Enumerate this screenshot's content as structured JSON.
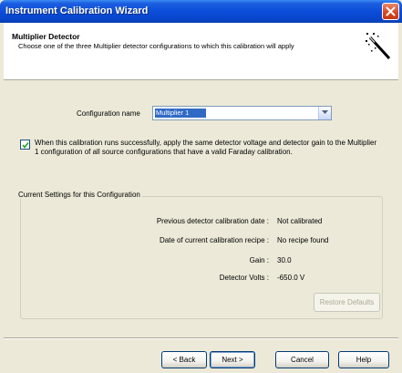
{
  "window": {
    "title": "Instrument Calibration Wizard"
  },
  "header": {
    "title": "Multiplier Detector",
    "subtitle": "Choose one of the three Multiplier detector configurations to which this calibration will apply"
  },
  "configuration": {
    "label": "Configuration name",
    "selected": "Multiplier 1"
  },
  "apply_checkbox": {
    "checked": true,
    "text": "When this calibration runs successfully, apply the same detector voltage and detector gain to the Multiplier 1 configuration of all source configurations that have a valid Faraday calibration."
  },
  "current_settings": {
    "legend": "Current Settings for this Configuration",
    "rows": [
      {
        "label": "Previous detector calibration date :",
        "value": "Not calibrated"
      },
      {
        "label": "Date of current calibration recipe :",
        "value": "No recipe found"
      },
      {
        "label": "Gain :",
        "value": "30.0"
      },
      {
        "label": "Detector Volts :",
        "value": "-650.0 V"
      }
    ],
    "restore_label": "Restore Defaults"
  },
  "buttons": {
    "back": "< Back",
    "next": "Next >",
    "cancel": "Cancel",
    "help": "Help"
  }
}
